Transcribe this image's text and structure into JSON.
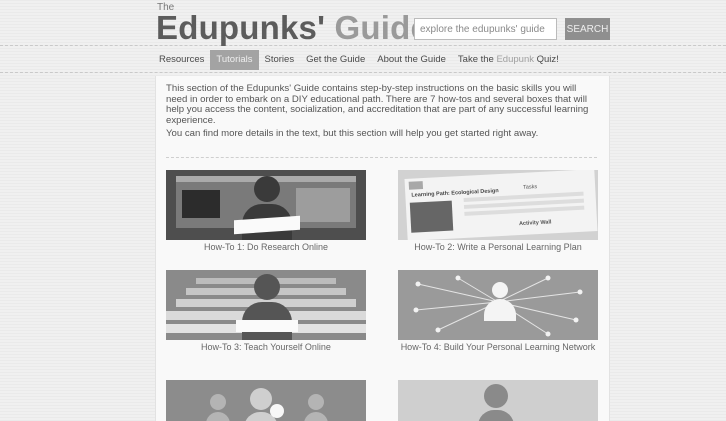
{
  "header": {
    "logo_small": "The",
    "logo_word1": "Edupunks'",
    "logo_word2": "Guide",
    "search_placeholder": "explore the edupunks' guide",
    "search_button": "SEARCH"
  },
  "nav": {
    "items": [
      {
        "label": "Resources"
      },
      {
        "label": "Tutorials",
        "active": true
      },
      {
        "label": "Stories"
      },
      {
        "label": "Get the Guide"
      },
      {
        "label": "About the Guide"
      }
    ],
    "quiz_prefix": "Take the ",
    "quiz_highlight": "Edupunk",
    "quiz_suffix": " Quiz!"
  },
  "intro": {
    "paragraph1": "This section of the Edupunks' Guide contains step-by-step instructions on the basic skills you will need in order to embark on a DIY educational path. There are 7 how-tos and several boxes that will help you access the content, socialization, and accreditation that are part of any successful learning experience.",
    "paragraph2": "You can find more details in the text, but this section will help you get started right away."
  },
  "tutorials": [
    {
      "caption": "How-To 1: Do Research Online"
    },
    {
      "caption": "How-To 2: Write a Personal Learning Plan"
    },
    {
      "caption": "How-To 3: Teach Yourself Online"
    },
    {
      "caption": "How-To 4: Build Your Personal Learning Network"
    }
  ],
  "thumb_text": {
    "plan_title": "Learning Path: Ecological Design",
    "plan_tasks": "Tasks",
    "plan_activity": "Activity Wall"
  }
}
